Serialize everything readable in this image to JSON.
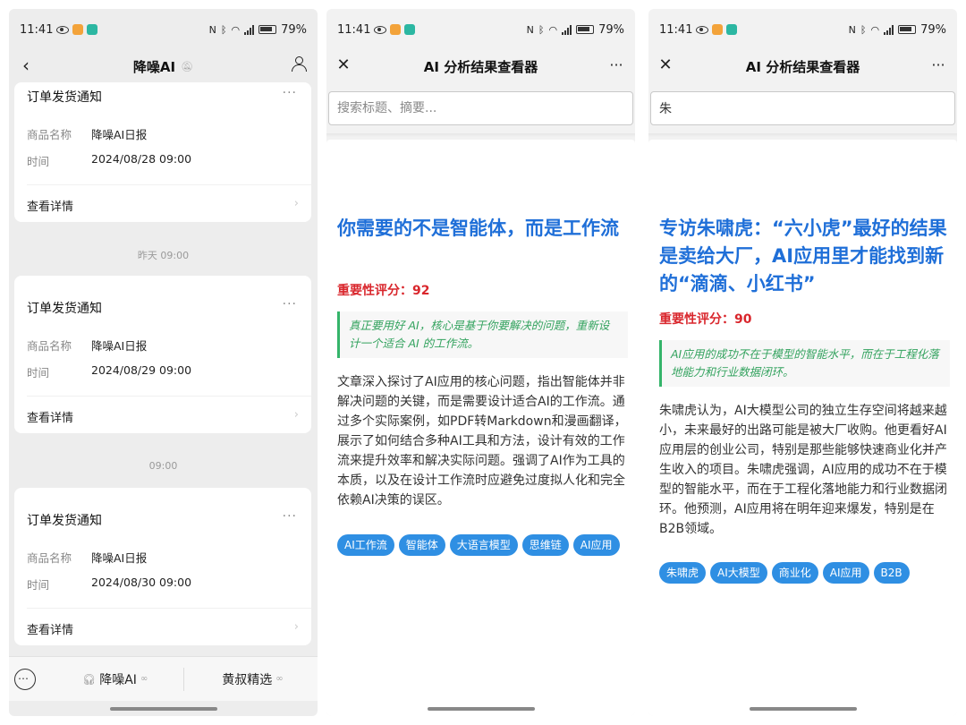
{
  "status": {
    "time": "11:41",
    "battery": "79%"
  },
  "chat": {
    "title": "降噪AI",
    "cards": [
      {
        "title": "订单发货通知",
        "product_key": "商品名称",
        "product_val": "降噪AI日报",
        "time_key": "时间",
        "time_val": "2024/08/28 09:00",
        "link": "查看详情"
      },
      {
        "title": "订单发货通知",
        "product_key": "商品名称",
        "product_val": "降噪AI日报",
        "time_key": "时间",
        "time_val": "2024/08/29 09:00",
        "link": "查看详情"
      },
      {
        "title": "订单发货通知",
        "product_key": "商品名称",
        "product_val": "降噪AI日报",
        "time_key": "时间",
        "time_val": "2024/08/30 09:00",
        "link": "查看详情"
      }
    ],
    "time_labels": [
      "昨天 09:00",
      "09:00"
    ],
    "bottom_tabs": [
      "降噪AI",
      "黄叔精选"
    ]
  },
  "viewer": {
    "title": "AI 分析结果查看器",
    "search_placeholder": "搜索标题、摘要..."
  },
  "article1": {
    "title": "你需要的不是智能体，而是工作流",
    "score": "重要性评分：92",
    "quote": "真正要用好 AI，核心是基于你要解决的问题，重新设计一个适合 AI 的工作流。",
    "summary": "文章深入探讨了AI应用的核心问题，指出智能体并非解决问题的关键，而是需要设计适合AI的工作流。通过多个实际案例，如PDF转Markdown和漫画翻译，展示了如何结合多种AI工具和方法，设计有效的工作流来提升效率和解决实际问题。强调了AI作为工具的本质，以及在设计工作流时应避免过度拟人化和完全依赖AI决策的误区。",
    "tags": [
      "AI工作流",
      "智能体",
      "大语言模型",
      "思维链",
      "AI应用"
    ]
  },
  "article2": {
    "search_value": "朱",
    "title": "专访朱啸虎：“六小虎”最好的结果是卖给大厂，AI应用里才能找到新的“滴滴、小红书”",
    "score": "重要性评分：90",
    "quote": "AI应用的成功不在于模型的智能水平，而在于工程化落地能力和行业数据闭环。",
    "summary": "朱啸虎认为，AI大模型公司的独立生存空间将越来越小，未来最好的出路可能是被大厂收购。他更看好AI应用层的创业公司，特别是那些能够快速商业化并产生收入的项目。朱啸虎强调，AI应用的成功不在于模型的智能水平，而在于工程化落地能力和行业数据闭环。他预测，AI应用将在明年迎来爆发，特别是在B2B领域。",
    "tags": [
      "朱啸虎",
      "AI大模型",
      "商业化",
      "AI应用",
      "B2B"
    ]
  }
}
